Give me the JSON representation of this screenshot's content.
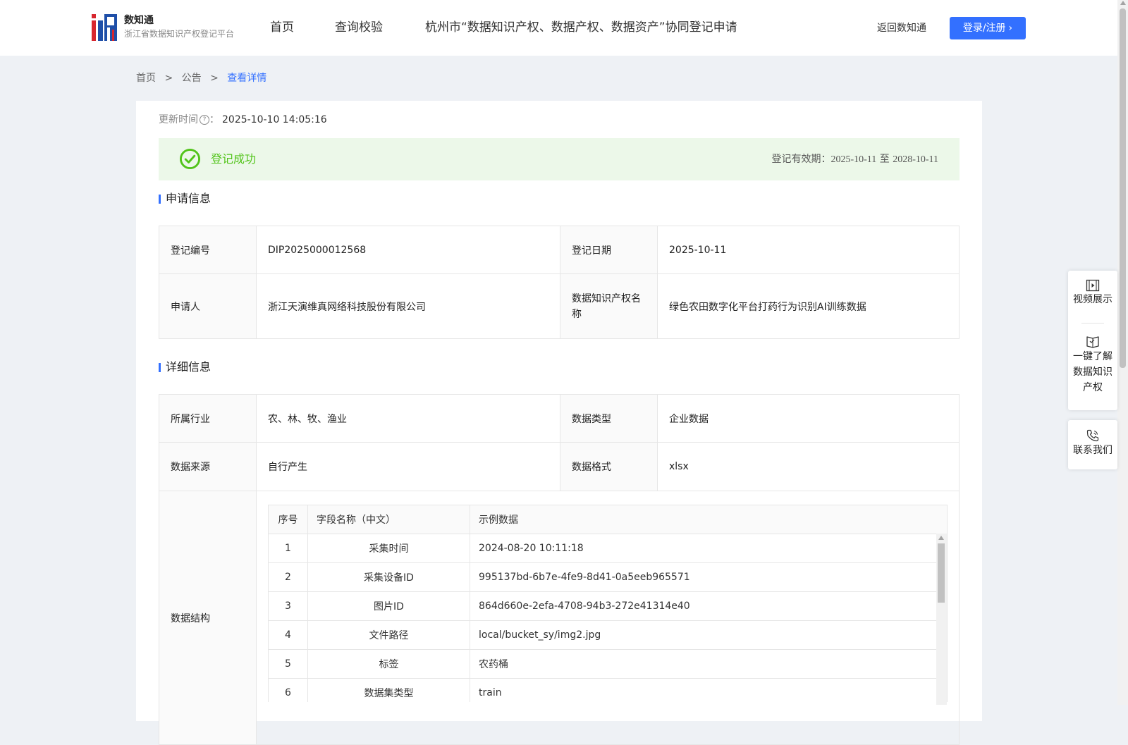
{
  "header": {
    "logo_title": "数知通",
    "logo_subtitle": "浙江省数据知识产权登记平台",
    "nav": [
      "首页",
      "查询校验",
      "杭州市“数据知识产权、数据产权、数据资产”协同登记申请"
    ],
    "back_link": "返回数知通",
    "login_button": "登录/注册"
  },
  "breadcrumb": {
    "home": "首页",
    "sep": ">",
    "notice": "公告",
    "current": "查看详情"
  },
  "update": {
    "label": "更新时间",
    "colon": "：",
    "value": "2025-10-10 14:05:16"
  },
  "status": {
    "text": "登记成功",
    "validity_label": "登记有效期：",
    "start": "2025-10-11",
    "to": "至",
    "end": "2028-10-11",
    "color": "#52c41a"
  },
  "apply_section": {
    "title": "申请信息",
    "rows": [
      {
        "l1": "登记编号",
        "v1": "DIP2025000012568",
        "l2": "登记日期",
        "v2": "2025-10-11"
      },
      {
        "l1": "申请人",
        "v1": "浙江天演维真网络科技股份有限公司",
        "l2": "数据知识产权名称",
        "v2": "绿色农田数字化平台打药行为识别AI训练数据"
      }
    ]
  },
  "detail_section": {
    "title": "详细信息",
    "rows": [
      {
        "l1": "所属行业",
        "v1": "农、林、牧、渔业",
        "l2": "数据类型",
        "v2": "企业数据"
      },
      {
        "l1": "数据来源",
        "v1": "自行产生",
        "l2": "数据格式",
        "v2": "xlsx"
      }
    ],
    "structure_label": "数据结构",
    "structure_headers": [
      "序号",
      "字段名称（中文）",
      "示例数据"
    ],
    "structure_rows": [
      [
        "1",
        "采集时间",
        "2024-08-20 10:11:18"
      ],
      [
        "2",
        "采集设备ID",
        "995137bd-6b7e-4fe9-8d41-0a5eeb965571"
      ],
      [
        "3",
        "图片ID",
        "864d660e-2efa-4708-94b3-272e41314e40"
      ],
      [
        "4",
        "文件路径",
        "local/bucket_sy/img2.jpg"
      ],
      [
        "5",
        "标签",
        "农药桶"
      ],
      [
        "6",
        "数据集类型",
        "train"
      ]
    ]
  },
  "float_panel": {
    "video": "视频展示",
    "learn": [
      "一键了解",
      "数据知识",
      "产权"
    ],
    "contact": "联系我们"
  },
  "colors": {
    "primary": "#3370ff",
    "success_bg": "#ecf8e9",
    "page_bg": "#eef1f5"
  }
}
